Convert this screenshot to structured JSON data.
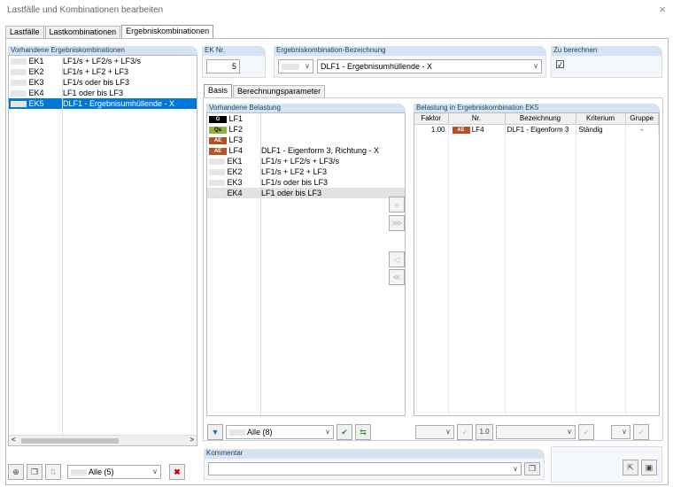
{
  "window": {
    "title": "Lastfälle und Kombinationen bearbeiten",
    "close": "×"
  },
  "tabs": [
    "Lastfälle",
    "Lastkombinationen",
    "Ergebniskombinationen"
  ],
  "left": {
    "header": "Vorhandene Ergebniskombinationen",
    "items": [
      {
        "id": "EK1",
        "desc": "LF1/s + LF2/s + LF3/s"
      },
      {
        "id": "EK2",
        "desc": "LF1/s + LF2 + LF3"
      },
      {
        "id": "EK3",
        "desc": "LF1/s oder bis LF3"
      },
      {
        "id": "EK4",
        "desc": "LF1 oder bis LF3"
      },
      {
        "id": "EK5",
        "desc": "DLF1 - Ergebnisumhüllende - X"
      }
    ],
    "filter": "Alle (5)"
  },
  "ek_nr": {
    "label": "EK Nr.",
    "value": "5"
  },
  "bezeichnung": {
    "label": "Ergebniskombination-Bezeichnung",
    "value": "DLF1 - Ergebnisumhüllende - X"
  },
  "zu_berechnen": {
    "label": "Zu berechnen",
    "checked": "☑"
  },
  "subtabs": [
    "Basis",
    "Berechnungsparameter"
  ],
  "vorhanden": {
    "header": "Vorhandene Belastung",
    "items": [
      {
        "tag": "G",
        "type": "g",
        "id": "LF1",
        "desc": ""
      },
      {
        "tag": "Qs",
        "type": "q",
        "id": "LF2",
        "desc": ""
      },
      {
        "tag": "AE",
        "type": "ae",
        "id": "LF3",
        "desc": ""
      },
      {
        "tag": "AE",
        "type": "ae",
        "id": "LF4",
        "desc": "DLF1 - Eigenform 3, Richtung - X"
      },
      {
        "tag": "",
        "type": "none",
        "id": "EK1",
        "desc": "LF1/s + LF2/s + LF3/s"
      },
      {
        "tag": "",
        "type": "none",
        "id": "EK2",
        "desc": "LF1/s + LF2 + LF3"
      },
      {
        "tag": "",
        "type": "none",
        "id": "EK3",
        "desc": "LF1/s oder bis LF3"
      },
      {
        "tag": "",
        "type": "none",
        "id": "EK4",
        "desc": "LF1 oder bis LF3"
      }
    ],
    "filter": "Alle (8)"
  },
  "belastung": {
    "header": "Belastung in Ergebniskombination EK5",
    "columns": [
      "Faktor",
      "Nr.",
      "Bezeichnung",
      "Kriterium",
      "Gruppe"
    ],
    "rows": [
      {
        "faktor": "1.00",
        "tag": "AE",
        "nr": "LF4",
        "bez": "DLF1 - Eigenform 3",
        "krit": "Ständig",
        "gruppe": "-"
      }
    ],
    "factor_btn": "1.0"
  },
  "kommentar": {
    "label": "Kommentar"
  }
}
